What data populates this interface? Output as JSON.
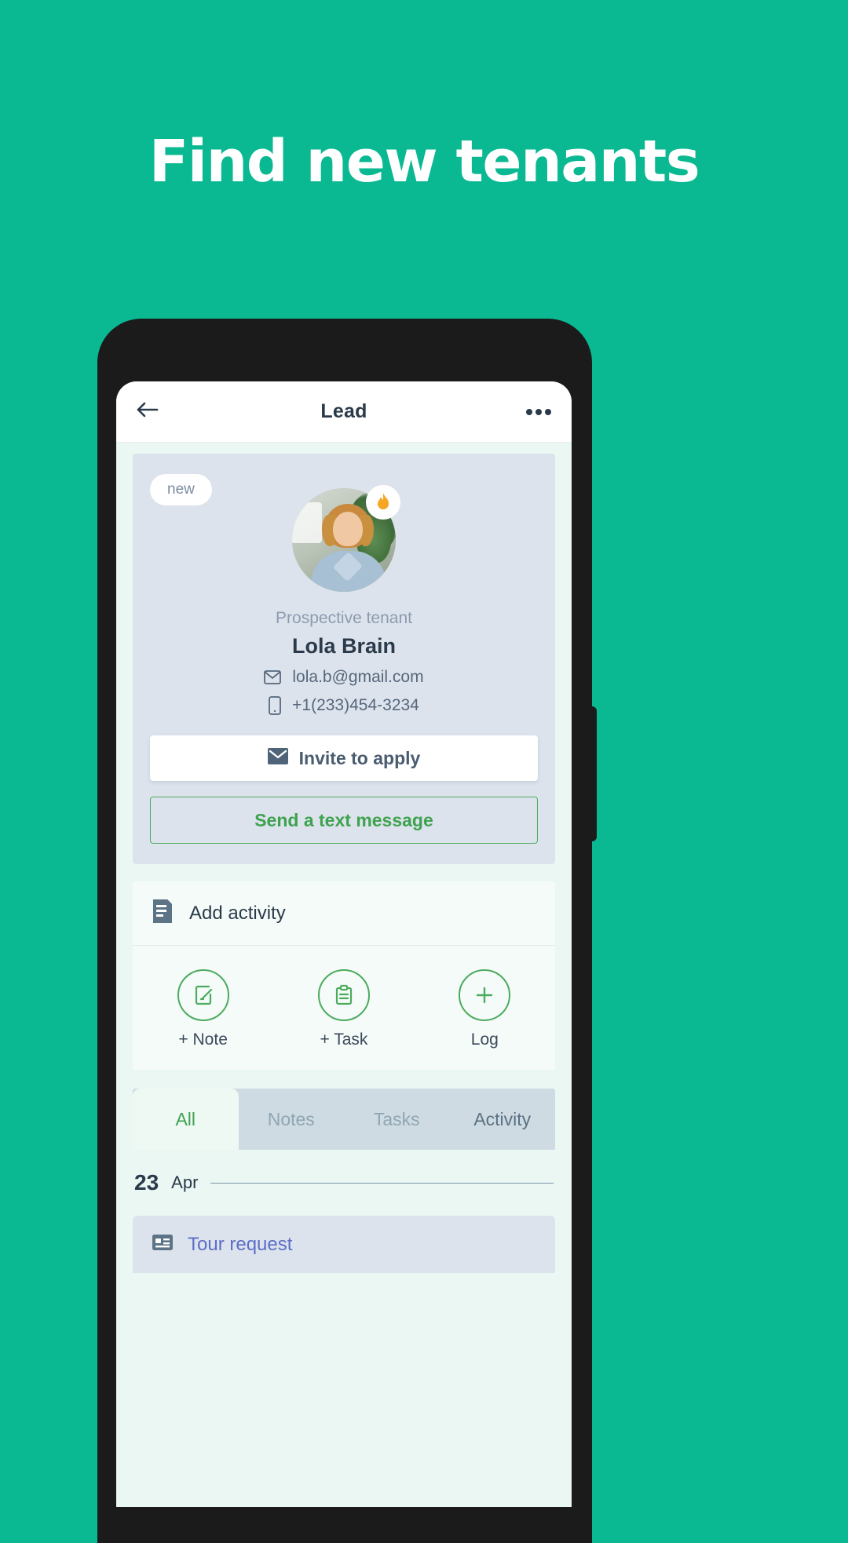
{
  "hero": {
    "headline": "Find new tenants",
    "background_color": "#0ab992"
  },
  "appbar": {
    "title": "Lead",
    "back_icon": "arrow-left-icon",
    "more_icon": "more-horizontal-icon"
  },
  "profile": {
    "badge": "new",
    "status_icon": "flame-icon",
    "role": "Prospective tenant",
    "name": "Lola Brain",
    "email": "lola.b@gmail.com",
    "email_icon": "envelope-icon",
    "phone": "+1(233)454-3234",
    "phone_icon": "mobile-phone-icon",
    "invite_button": "Invite to apply",
    "invite_icon": "envelope-filled-icon",
    "text_button": "Send a text message",
    "card_color": "#dde3ec"
  },
  "activity": {
    "header_label": "Add activity",
    "header_icon": "document-lines-icon",
    "actions": [
      {
        "label": "+ Note",
        "icon": "note-edit-icon"
      },
      {
        "label": "+ Task",
        "icon": "clipboard-icon"
      },
      {
        "label": "Log",
        "icon": "plus-icon"
      }
    ],
    "accent_color": "#4bab5e"
  },
  "tabs": [
    {
      "label": "All",
      "active": true
    },
    {
      "label": "Notes",
      "active": false
    },
    {
      "label": "Tasks",
      "active": false
    },
    {
      "label": "Activity",
      "active": false
    }
  ],
  "timeline": {
    "date_day": "23",
    "date_month": "Apr",
    "items": [
      {
        "title": "Tour request",
        "icon": "card-contact-icon"
      }
    ]
  }
}
